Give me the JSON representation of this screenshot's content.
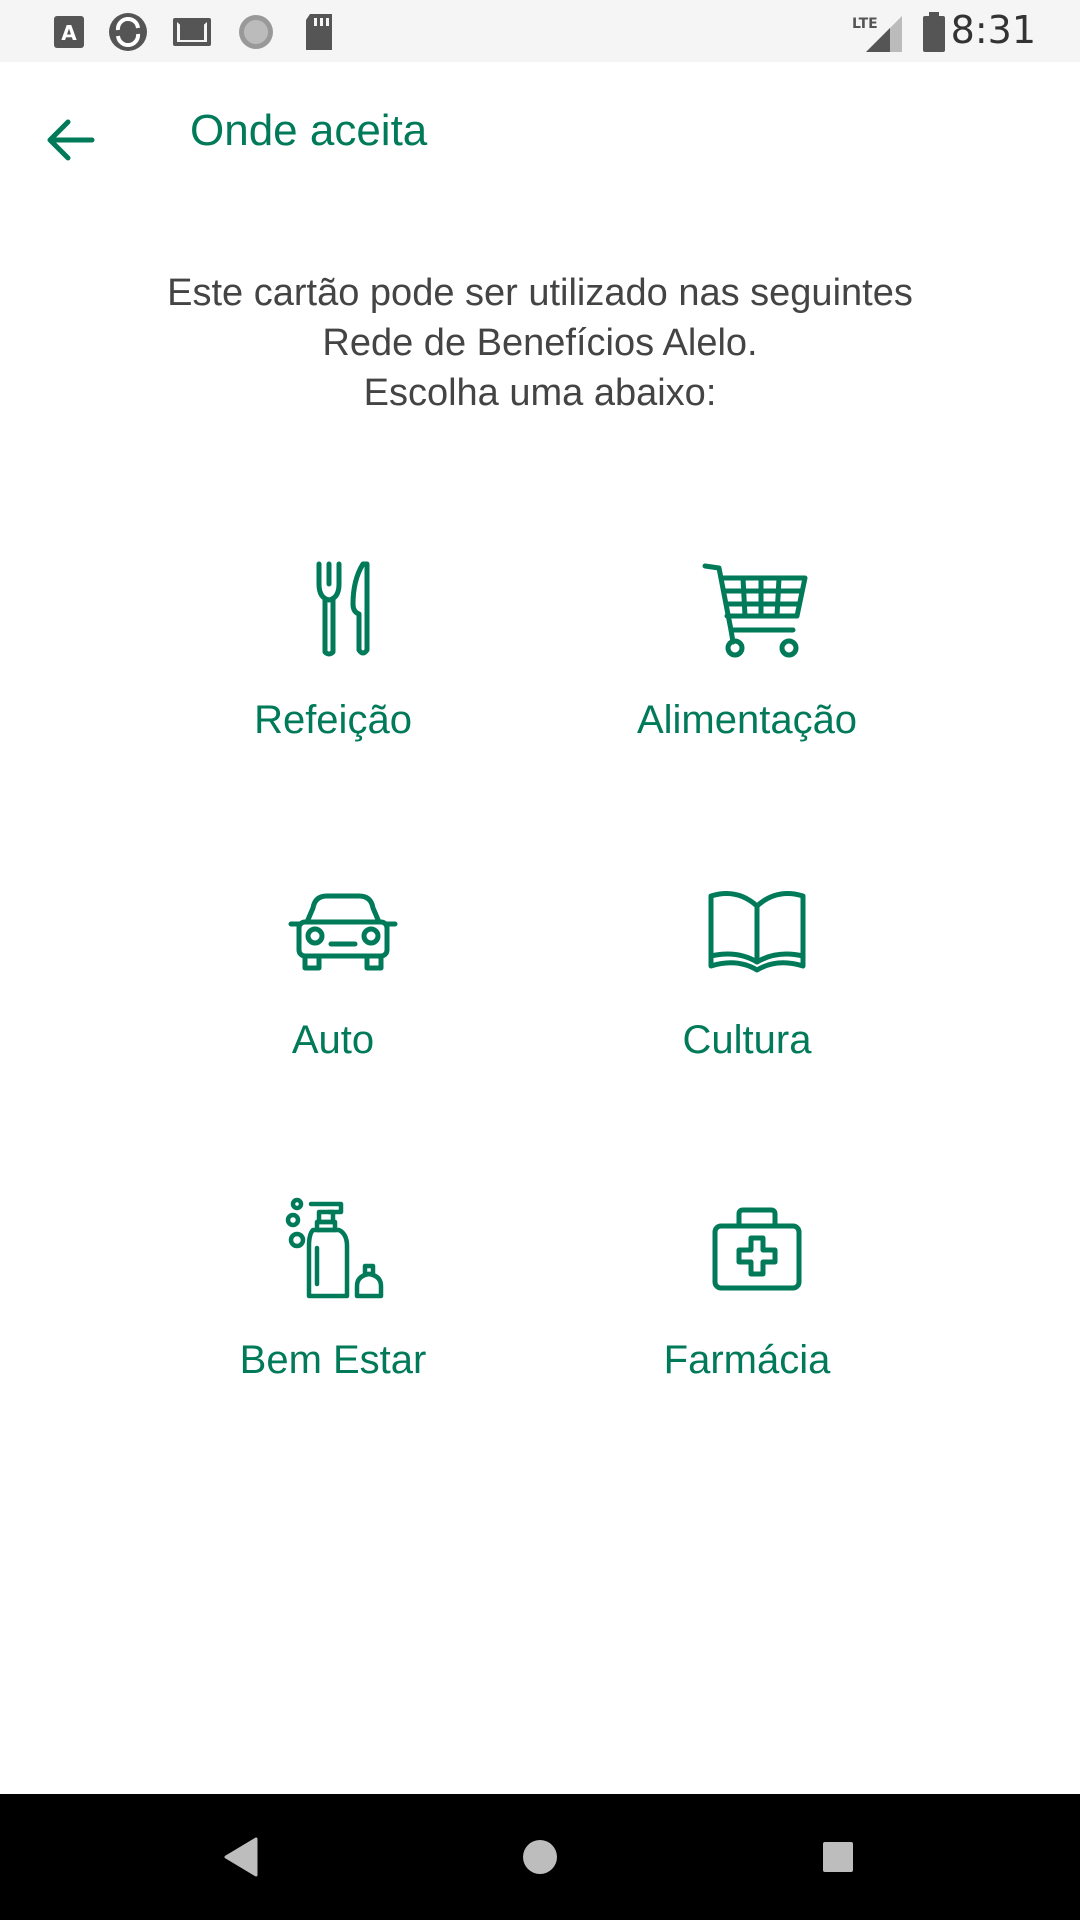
{
  "status_bar": {
    "time": "8:31",
    "network": "LTE",
    "icons": [
      "font-icon",
      "sync-app-icon",
      "gmail-icon",
      "loading-icon",
      "sd-card-icon",
      "signal-icon",
      "battery-icon"
    ]
  },
  "app_bar": {
    "back_icon": "arrow-left-icon",
    "title": "Onde aceita"
  },
  "description": {
    "line1": "Este cartão pode ser utilizado nas seguintes",
    "line2": "Rede de Benefícios Alelo.",
    "line3": "Escolha uma abaixo:"
  },
  "categories": [
    {
      "label": "Refeição",
      "icon": "fork-knife-icon"
    },
    {
      "label": "Alimentação",
      "icon": "shopping-cart-icon"
    },
    {
      "label": "Auto",
      "icon": "car-icon"
    },
    {
      "label": "Cultura",
      "icon": "open-book-icon"
    },
    {
      "label": "Bem Estar",
      "icon": "soap-bottle-icon"
    },
    {
      "label": "Farmácia",
      "icon": "first-aid-kit-icon"
    }
  ],
  "nav_bar": {
    "buttons": [
      "back-triangle-icon",
      "home-circle-icon",
      "recents-square-icon"
    ]
  },
  "colors": {
    "accent": "#007a59",
    "text": "#444444",
    "status_bar_bg": "#f5f5f5",
    "nav_bar_bg": "#000000"
  }
}
